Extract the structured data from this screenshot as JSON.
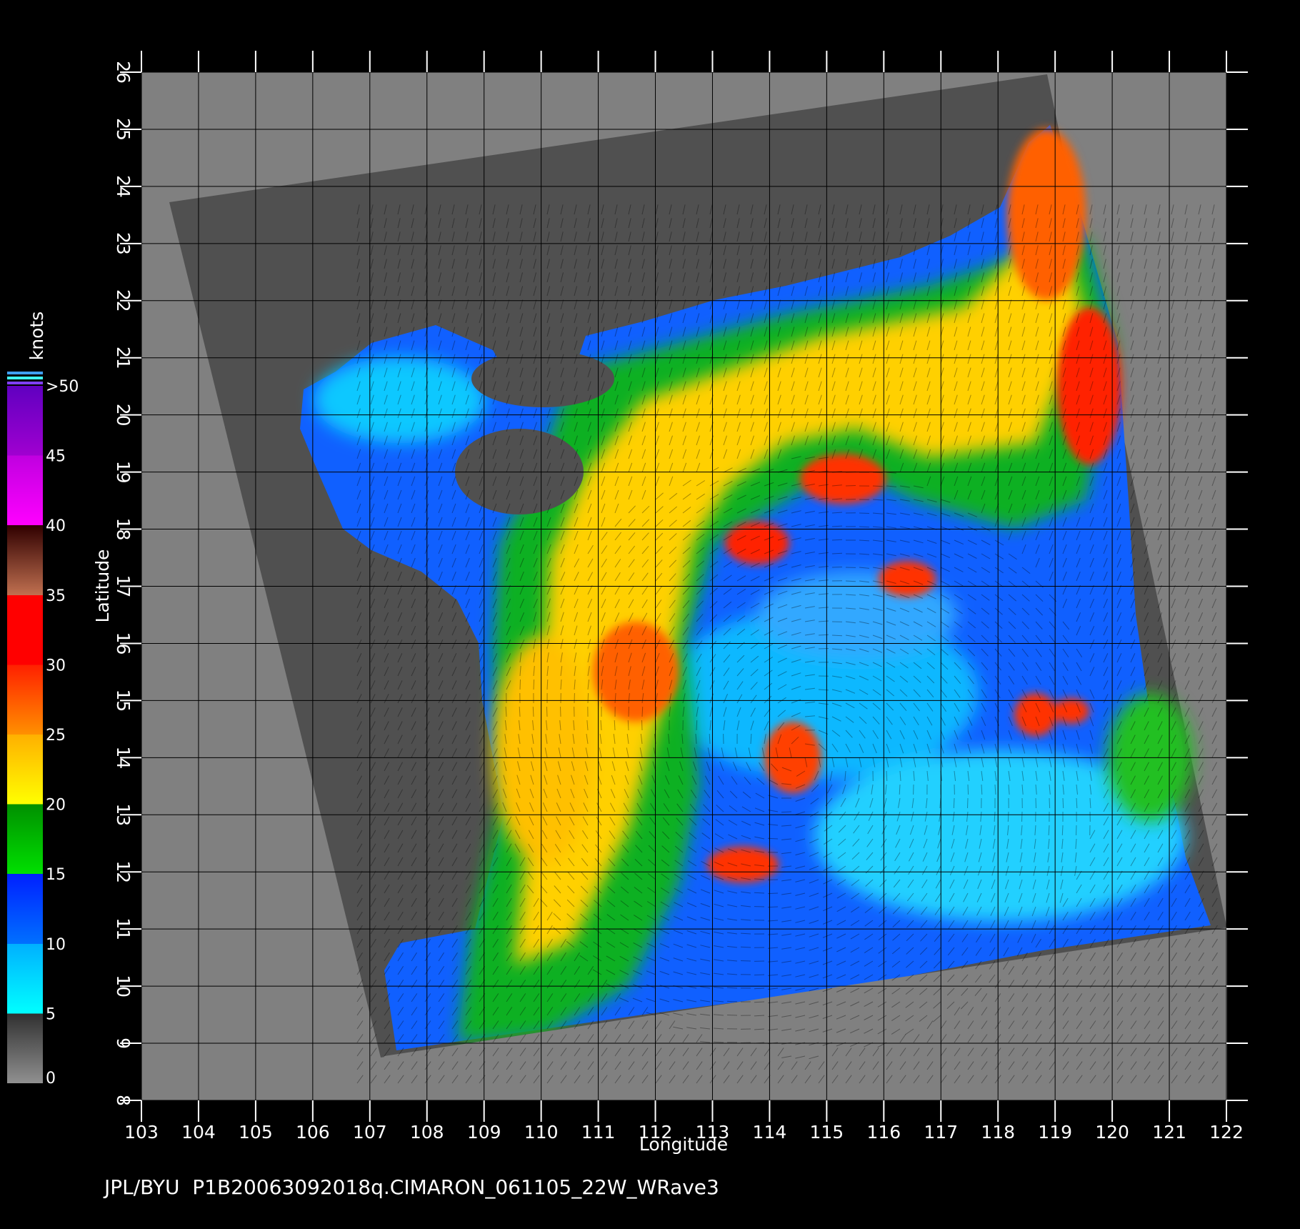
{
  "chart_data": {
    "type": "map",
    "product": "JPL/BYU  P1B20063092018q.CIMARON_061105_22W_WRave3",
    "xlabel": "Longitude",
    "ylabel": "Latitude",
    "x_ticks": [
      "103",
      "104",
      "105",
      "106",
      "107",
      "108",
      "109",
      "110",
      "111",
      "112",
      "113",
      "114",
      "115",
      "116",
      "117",
      "118",
      "119",
      "120",
      "121",
      "122"
    ],
    "y_ticks": [
      "8",
      "9",
      "10",
      "11",
      "12",
      "13",
      "14",
      "15",
      "16",
      "17",
      "18",
      "19",
      "20",
      "21",
      "22",
      "23",
      "24",
      "25",
      "26"
    ],
    "xlim": [
      103,
      122
    ],
    "ylim": [
      8,
      26
    ],
    "colorbar": {
      "title": "knots",
      "labels": [
        "0",
        "5",
        "10",
        "15",
        "20",
        "25",
        "30",
        "35",
        "40",
        "45",
        ">50"
      ],
      "stops": [
        {
          "from": 0,
          "to": 5,
          "color": "#404040",
          "to_color": "#808080"
        },
        {
          "from": 5,
          "to": 10,
          "color": "#00e8ff"
        },
        {
          "from": 10,
          "to": 15,
          "color": "#0030ff"
        },
        {
          "from": 15,
          "to": 20,
          "color": "#00c800"
        },
        {
          "from": 20,
          "to": 25,
          "color": "#ffd400"
        },
        {
          "from": 25,
          "to": 30,
          "color": "#ff5000"
        },
        {
          "from": 30,
          "to": 35,
          "color": "#ff0000"
        },
        {
          "from": 35,
          "to": 40,
          "color": "#503020"
        },
        {
          "from": 40,
          "to": 45,
          "color": "#ff00ff"
        },
        {
          "from": 45,
          "to": 50,
          "color": "#8000d0"
        }
      ]
    },
    "colors": {
      "background": "#000000",
      "land": "#808080",
      "no_data": "#505050",
      "grid": "#000000"
    }
  }
}
